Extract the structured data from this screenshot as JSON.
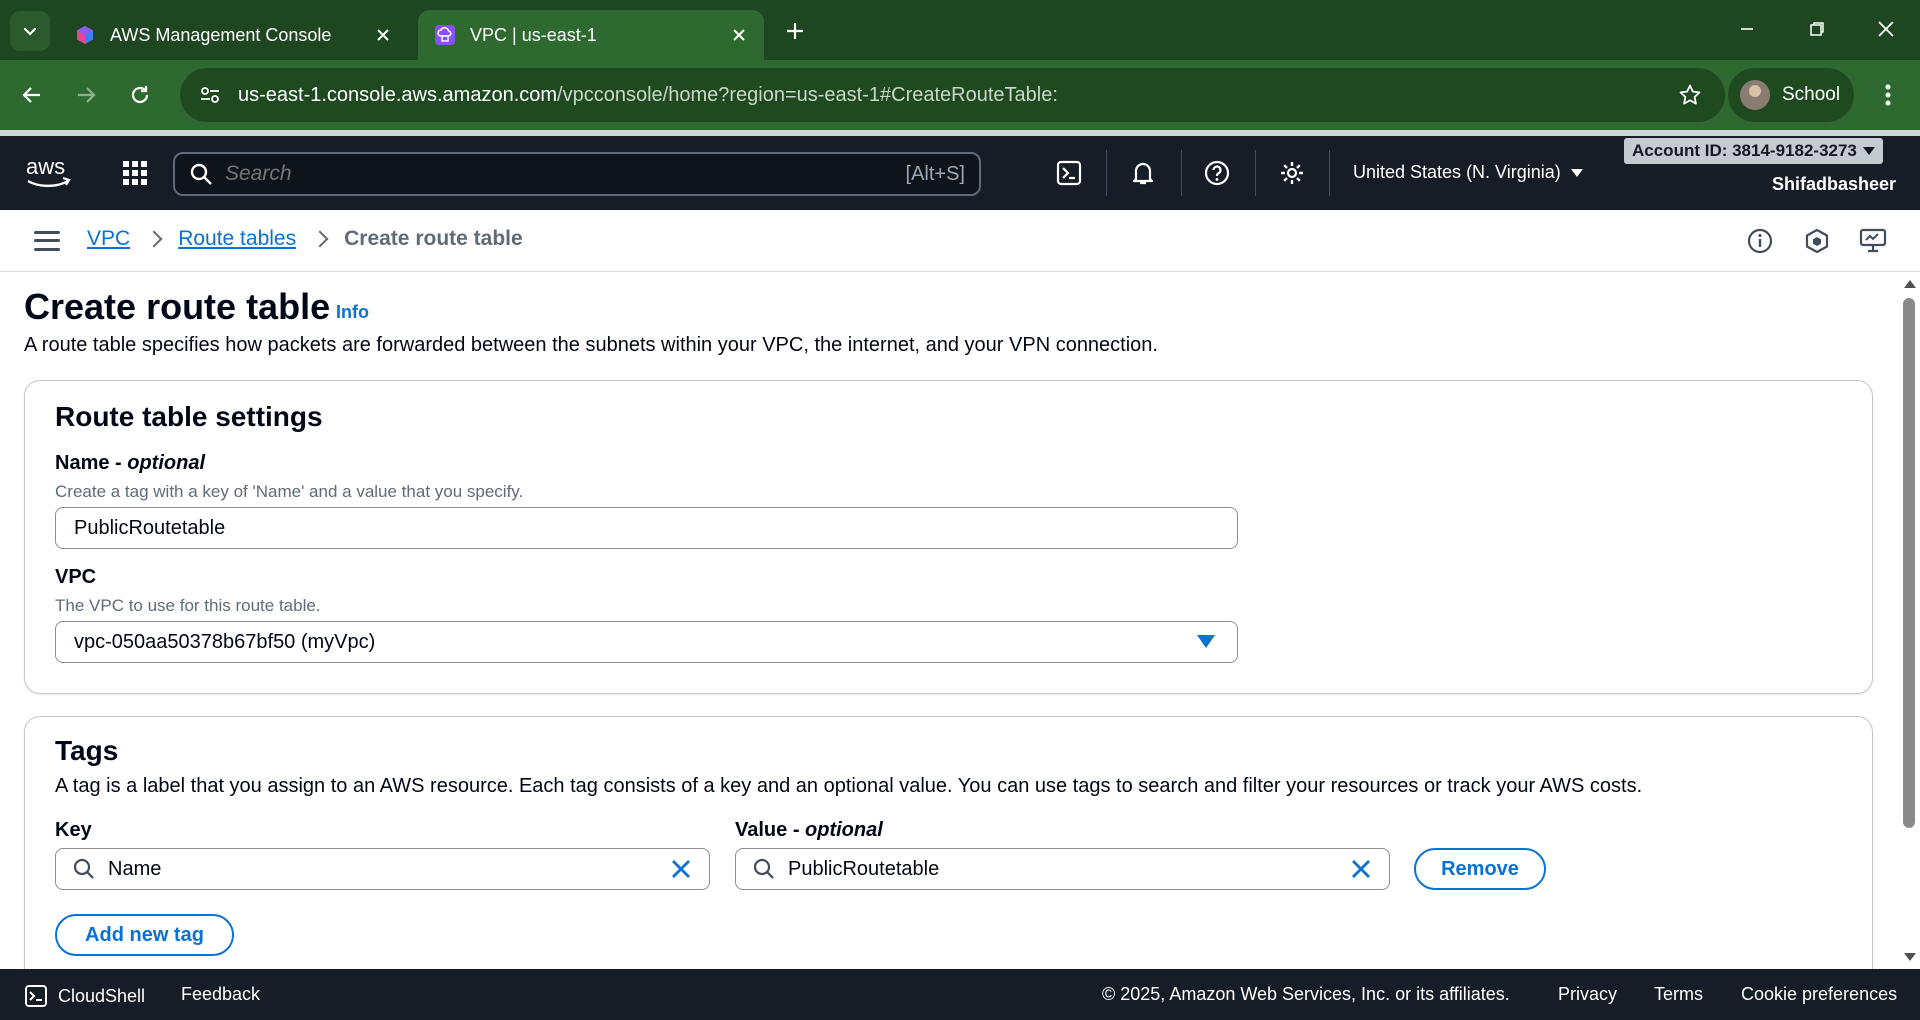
{
  "browser": {
    "tabs": [
      {
        "title": "AWS Management Console",
        "icon": "aws-cube-icon"
      },
      {
        "title": "VPC | us-east-1",
        "icon": "vpc-icon",
        "active": true
      }
    ],
    "url_host": "us-east-1.console.aws.amazon.com",
    "url_path": "/vpcconsole/home?region=us-east-1#CreateRouteTable:",
    "profile_label": "School"
  },
  "aws_header": {
    "search_placeholder": "Search",
    "search_shortcut": "[Alt+S]",
    "region": "United States (N. Virginia)",
    "account_id": "Account ID: 3814-9182-3273",
    "username": "Shifadbasheer"
  },
  "breadcrumbs": {
    "items": [
      "VPC",
      "Route tables"
    ],
    "current": "Create route table"
  },
  "page": {
    "title": "Create route table",
    "info": "Info",
    "description": "A route table specifies how packets are forwarded between the subnets within your VPC, the internet, and your VPN connection."
  },
  "settings": {
    "title": "Route table settings",
    "name_label": "Name - ",
    "name_label_optional": "optional",
    "name_desc": "Create a tag with a key of 'Name' and a value that you specify.",
    "name_value": "PublicRoutetable",
    "vpc_label": "VPC",
    "vpc_desc": "The VPC to use for this route table.",
    "vpc_value": "vpc-050aa50378b67bf50 (myVpc)"
  },
  "tags": {
    "title": "Tags",
    "description": "A tag is a label that you assign to an AWS resource. Each tag consists of a key and an optional value. You can use tags to search and filter your resources or track your AWS costs.",
    "key_label": "Key",
    "value_label": "Value - ",
    "value_label_optional": "optional",
    "key_value": "Name",
    "value_value": "PublicRoutetable",
    "remove_label": "Remove",
    "add_label": "Add new tag"
  },
  "footer": {
    "cloudshell": "CloudShell",
    "feedback": "Feedback",
    "copyright": "© 2025, Amazon Web Services, Inc. or its affiliates.",
    "privacy": "Privacy",
    "terms": "Terms",
    "cookies": "Cookie preferences"
  },
  "colors": {
    "chrome_dark": "#1e4620",
    "chrome_mid": "#2e6a2f",
    "aws_nav": "#161d26",
    "link_blue": "#0972d3"
  }
}
